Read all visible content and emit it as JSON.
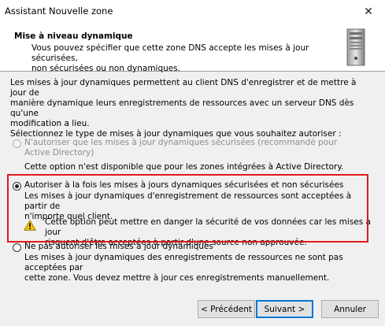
{
  "window": {
    "title": "Assistant Nouvelle zone",
    "close_glyph": "✕"
  },
  "header": {
    "title": "Mise à niveau dynamique",
    "desc_line1": "Vous pouvez spécifier que cette zone DNS accepte les mises à jour sécurisées,",
    "desc_line2": "non sécurisées ou non dynamiques.",
    "icon": "server-icon"
  },
  "intro": {
    "line1": "Les mises à jour dynamiques permettent au client DNS d'enregistrer et de mettre à jour de",
    "line2": "manière dynamique leurs enregistrements de ressources avec un serveur DNS dès qu'une",
    "line3": "modification a lieu.",
    "line4": "Sélectionnez le type de mises à jour dynamiques que vous souhaitez autoriser :"
  },
  "options": {
    "secure": {
      "label_line1": "N'autoriser que les mises à jour dynamiques sécurisées (recommandé pour",
      "label_line2": "Active Directory)",
      "note": "Cette option n'est disponible que pour les zones intégrées à Active Directory.",
      "enabled": false,
      "selected": false
    },
    "both": {
      "label": "Autoriser à la fois les mises à jours dynamiques sécurisées et non sécurisées",
      "desc_line1": "Les mises à jour dynamiques d'enregistrement de ressources sont acceptées à partir de",
      "desc_line2": "n'importe quel client.",
      "warning_line1": "Cette option peut mettre en danger la sécurité de vos données car les mises à jour",
      "warning_line2": "risquent d'être acceptées à partir d'une source non approuvée.",
      "selected": true
    },
    "none": {
      "label": "Ne pas autoriser les mises à jour dynamiques",
      "desc_line1": "Les mises à jour dynamiques des enregistrements de ressources ne sont pas acceptées par",
      "desc_line2": "cette zone. Vous devez mettre à jour ces enregistrements manuellement.",
      "selected": false
    }
  },
  "buttons": {
    "back": "< Précédent",
    "next": "Suivant >",
    "cancel": "Annuler"
  },
  "colors": {
    "highlight": "#e0191c",
    "warning": "#f5c400",
    "primary_border": "#0078d7"
  }
}
